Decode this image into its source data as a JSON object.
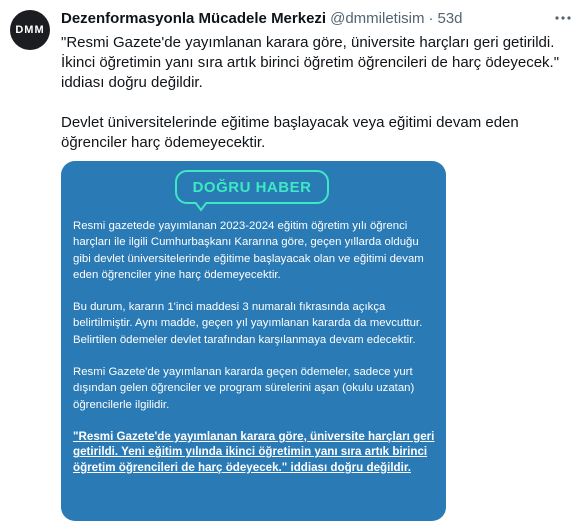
{
  "tweet": {
    "display_name": "Dezenformasyonla Mücadele Merkezi",
    "handle": "@dmmiletisim",
    "separator": "·",
    "time": "53d",
    "avatar_text": "DMM",
    "more_icon": "more-icon",
    "text_paragraphs": [
      "\"Resmi Gazete'de yayımlanan karara göre, üniversite harçları geri getirildi. İkinci öğretimin yanı sıra artık birinci öğretim öğrencileri de harç ödeyecek.\" iddiası doğru değildir.",
      "Devlet üniversitelerinde eğitime başlayacak veya eğitimi devam eden öğrenciler harç ödemeyecektir."
    ]
  },
  "card": {
    "background": "#2a7ab5",
    "badge_color": "#3ee8c3",
    "badge_label": "DOĞRU HABER",
    "paragraphs": [
      "Resmi gazetede yayımlanan 2023-2024 eğitim öğretim yılı öğrenci harçları ile ilgili Cumhurbaşkanı Kararına göre, geçen yıllarda olduğu gibi devlet üniversitelerinde eğitime başlayacak olan ve eğitimi devam eden öğrenciler yine harç ödemeyecektir.",
      "Bu durum, kararın 1'inci maddesi 3 numaralı fıkrasında açıkça belirtilmiştir. Aynı madde, geçen yıl yayımlanan kararda da mevcuttur. Belirtilen ödemeler devlet tarafından karşılanmaya devam edecektir.",
      "Resmi Gazete'de yayımlanan kararda geçen ödemeler, sadece yurt dışından gelen öğrenciler ve program sürelerini aşan (okulu uzatan) öğrencilerle ilgilidir."
    ],
    "claim": "\"Resmi Gazete'de yayımlanan karara göre, üniversite harçları geri getirildi. Yeni eğitim yılında ikinci öğretimin yanı sıra artık birinci öğretim öğrencileri de harç ödeyecek.\" iddiası doğru değildir."
  }
}
